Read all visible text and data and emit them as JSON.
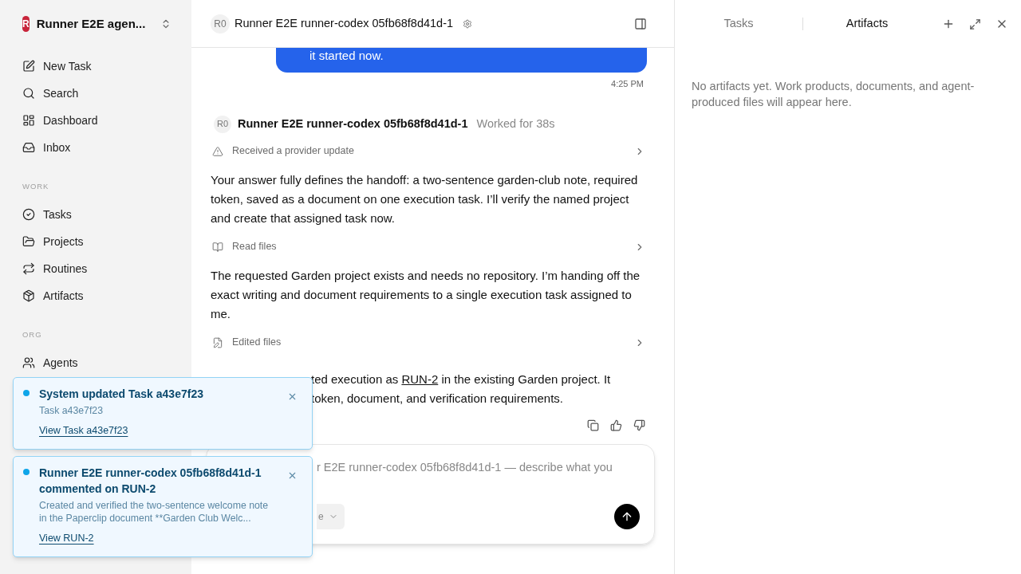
{
  "sidebar": {
    "workspace": "Runner E2E agen...",
    "logo_letter": "R",
    "top_items": [
      {
        "label": "New Task",
        "selected": false
      },
      {
        "label": "Search",
        "selected": false
      },
      {
        "label": "Dashboard",
        "selected": false
      },
      {
        "label": "Inbox",
        "selected": false
      }
    ],
    "sections": [
      {
        "heading": "WORK",
        "items": [
          {
            "label": "Tasks",
            "selected": false
          },
          {
            "label": "Projects",
            "selected": false
          },
          {
            "label": "Routines",
            "selected": false
          },
          {
            "label": "Artifacts",
            "selected": false
          }
        ]
      },
      {
        "heading": "ORG",
        "items": [
          {
            "label": "Agents",
            "selected": false
          }
        ]
      }
    ]
  },
  "header": {
    "avatar": "R0",
    "title": "Runner E2E runner-codex 05fb68f8d41d-1"
  },
  "chat": {
    "user_message": "it started now.",
    "time": "4:25 PM",
    "agent": {
      "avatar": "R0",
      "name": "Runner E2E runner-codex 05fb68f8d41d-1",
      "status": "Worked for 38s"
    },
    "blocks": [
      {
        "kind": "warning",
        "text": "Received a provider update"
      },
      {
        "kind": "text",
        "text": "Your answer fully defines the handoff: a two-sentence garden-club note, required token, saved as a document on one execution task. I’ll verify the named project and create that assigned task now."
      },
      {
        "kind": "read",
        "text": "Read files"
      },
      {
        "kind": "text",
        "text": "The requested Garden project exists and needs no repository. I’m handing off the exact writing and document requirements to a single execution task assigned to me."
      },
      {
        "kind": "edit",
        "text": "Edited files"
      }
    ],
    "partial_message": {
      "before": "ted execution as",
      "link": "RUN-2",
      "after": "in the existing Garden project. It",
      "line2": "token, document, and verification requirements."
    }
  },
  "composer": {
    "placeholder": "r E2E runner-codex 05fb68f8d41d-1 — describe what you",
    "model": "e"
  },
  "panel": {
    "tabs": [
      {
        "label": "Tasks",
        "selected": false
      },
      {
        "label": "Artifacts",
        "selected": true
      }
    ],
    "empty_text": "No artifacts yet. Work products, documents, and agent-produced files will appear here."
  },
  "toasts": [
    {
      "unread": true,
      "title": "System updated Task a43e7f23",
      "body": "Task a43e7f23",
      "link": "View Task a43e7f23"
    },
    {
      "unread": true,
      "title": "Runner E2E runner-codex 05fb68f8d41d-1 commented on RUN-2",
      "body": "Created and verified the two-sentence welcome note in the Paperclip document **Garden Club Welc...",
      "link": "View RUN-2"
    }
  ]
}
